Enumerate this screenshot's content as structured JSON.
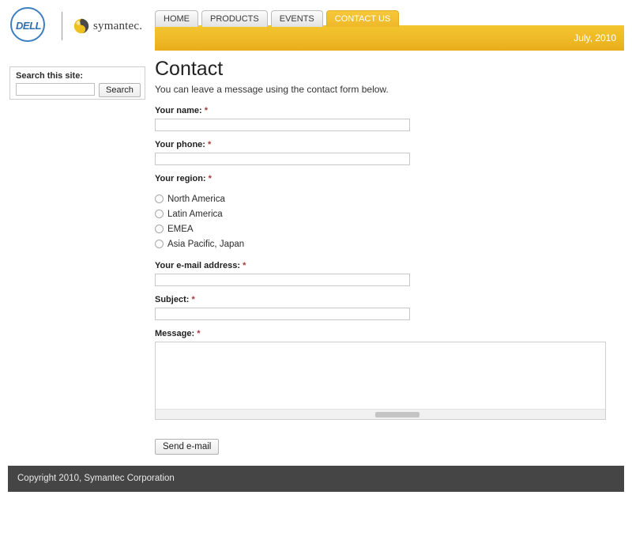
{
  "header": {
    "dell_logo_text": "DELL",
    "dell_logo_name": "dell-logo",
    "symantec_word": "symantec.",
    "symantec_mark_name": "symantec-swirl-icon",
    "brand_blue": "#3c7fc0",
    "symantec_yellow": "#f0c020",
    "symantec_dark": "#3b3b3b"
  },
  "nav": {
    "tabs": [
      {
        "label": "HOME",
        "active": false
      },
      {
        "label": "PRODUCTS",
        "active": false
      },
      {
        "label": "EVENTS",
        "active": false
      },
      {
        "label": "CONTACT US",
        "active": true
      }
    ],
    "active_tab_color": "#efb828"
  },
  "banner": {
    "date": "July, 2010",
    "background_color": "#eeb825"
  },
  "sidebar": {
    "search": {
      "label": "Search this site:",
      "input_value": "",
      "input_placeholder": "",
      "button_label": "Search"
    }
  },
  "main": {
    "title": "Contact",
    "intro": "You can leave a message using the contact form below.",
    "required_marker": "*",
    "fields": [
      {
        "label": "Your name:",
        "value": "",
        "placeholder": "",
        "required": true
      },
      {
        "label": "Your phone:",
        "value": "",
        "placeholder": "",
        "required": true
      }
    ],
    "region": {
      "label": "Your region:",
      "required": true,
      "options": [
        {
          "label": "North America",
          "selected": false
        },
        {
          "label": "Latin America",
          "selected": false
        },
        {
          "label": "EMEA",
          "selected": false
        },
        {
          "label": "Asia Pacific, Japan",
          "selected": false
        }
      ]
    },
    "fields2": [
      {
        "label": "Your e-mail address:",
        "value": "",
        "placeholder": "",
        "required": true
      },
      {
        "label": "Subject:",
        "value": "",
        "placeholder": "",
        "required": true
      }
    ],
    "message": {
      "label": "Message:",
      "required": true,
      "value": "",
      "placeholder": ""
    },
    "submit_label": "Send e-mail"
  },
  "footer": {
    "copyright": "Copyright 2010, Symantec Corporation",
    "background_color": "#454545"
  }
}
